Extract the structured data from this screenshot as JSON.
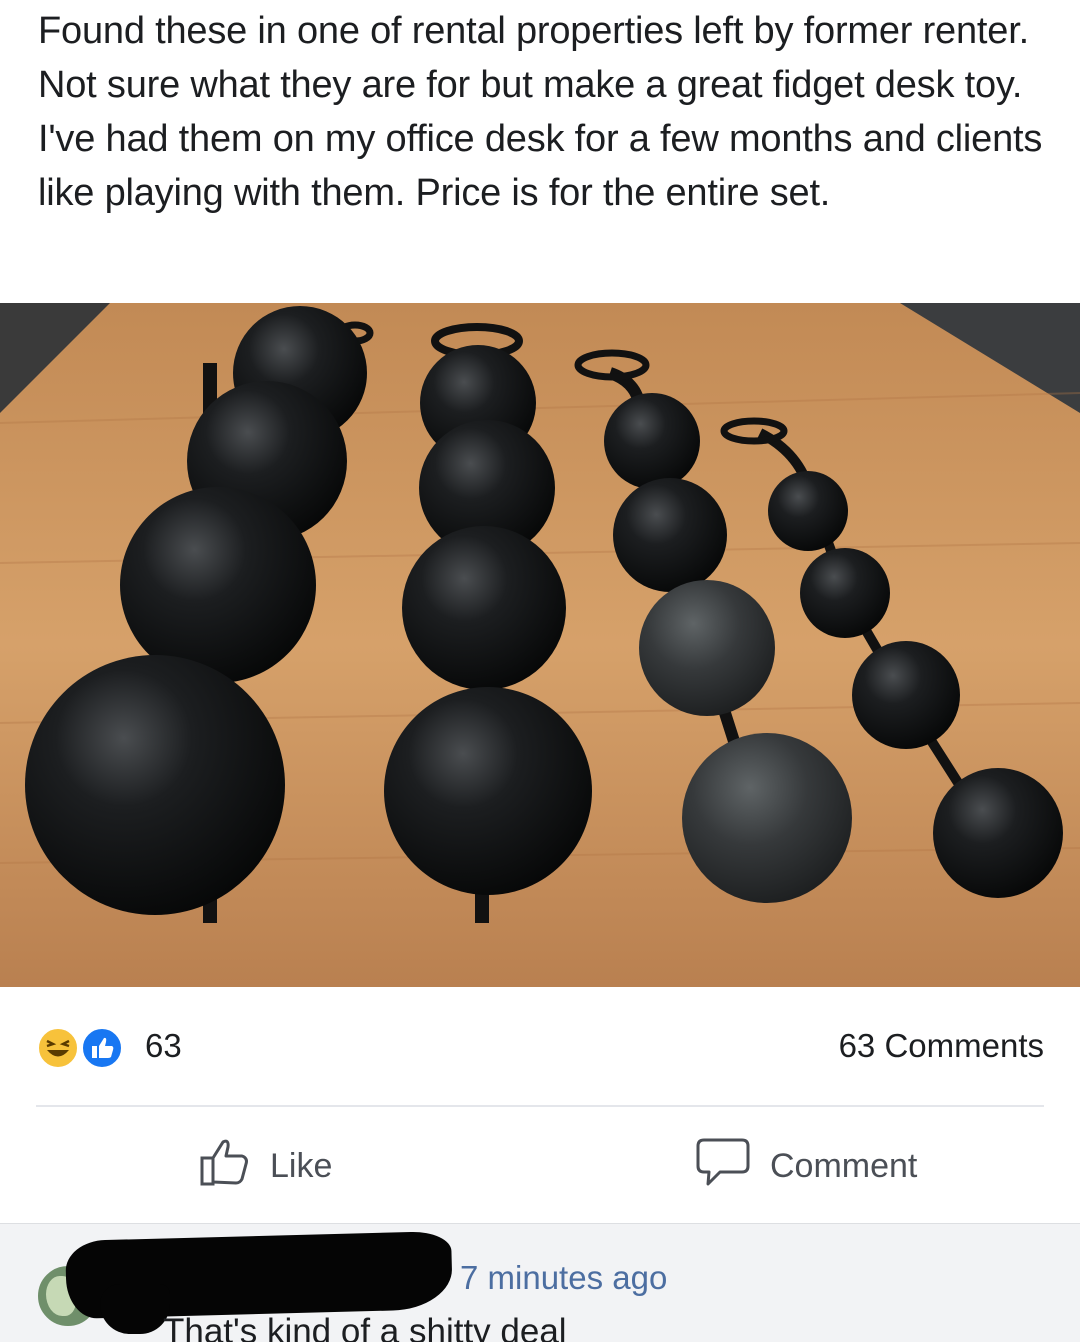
{
  "post": {
    "text": "Found these in one of rental properties left by former renter. Not sure what they are for but make a great fidget desk toy. I've had them on my office desk for a few months and clients like playing with them. Price is for the entire set."
  },
  "photo": {
    "subject": "four black bead strands on a wooden desk"
  },
  "reactions": {
    "icons": [
      "haha-reaction-icon",
      "like-reaction-icon"
    ],
    "count": "63",
    "comments_count": "63 Comments"
  },
  "actions": {
    "like_label": "Like",
    "comment_label": "Comment"
  },
  "comment": {
    "timestamp": "7 minutes ago",
    "text": "That's kind of a shitty deal"
  },
  "colors": {
    "link_blue": "#4c6ea1",
    "like_blue": "#1877f2",
    "haha_yellow": "#f7c23b",
    "action_gray": "#4b4f56",
    "comment_bg": "#f2f3f5"
  }
}
